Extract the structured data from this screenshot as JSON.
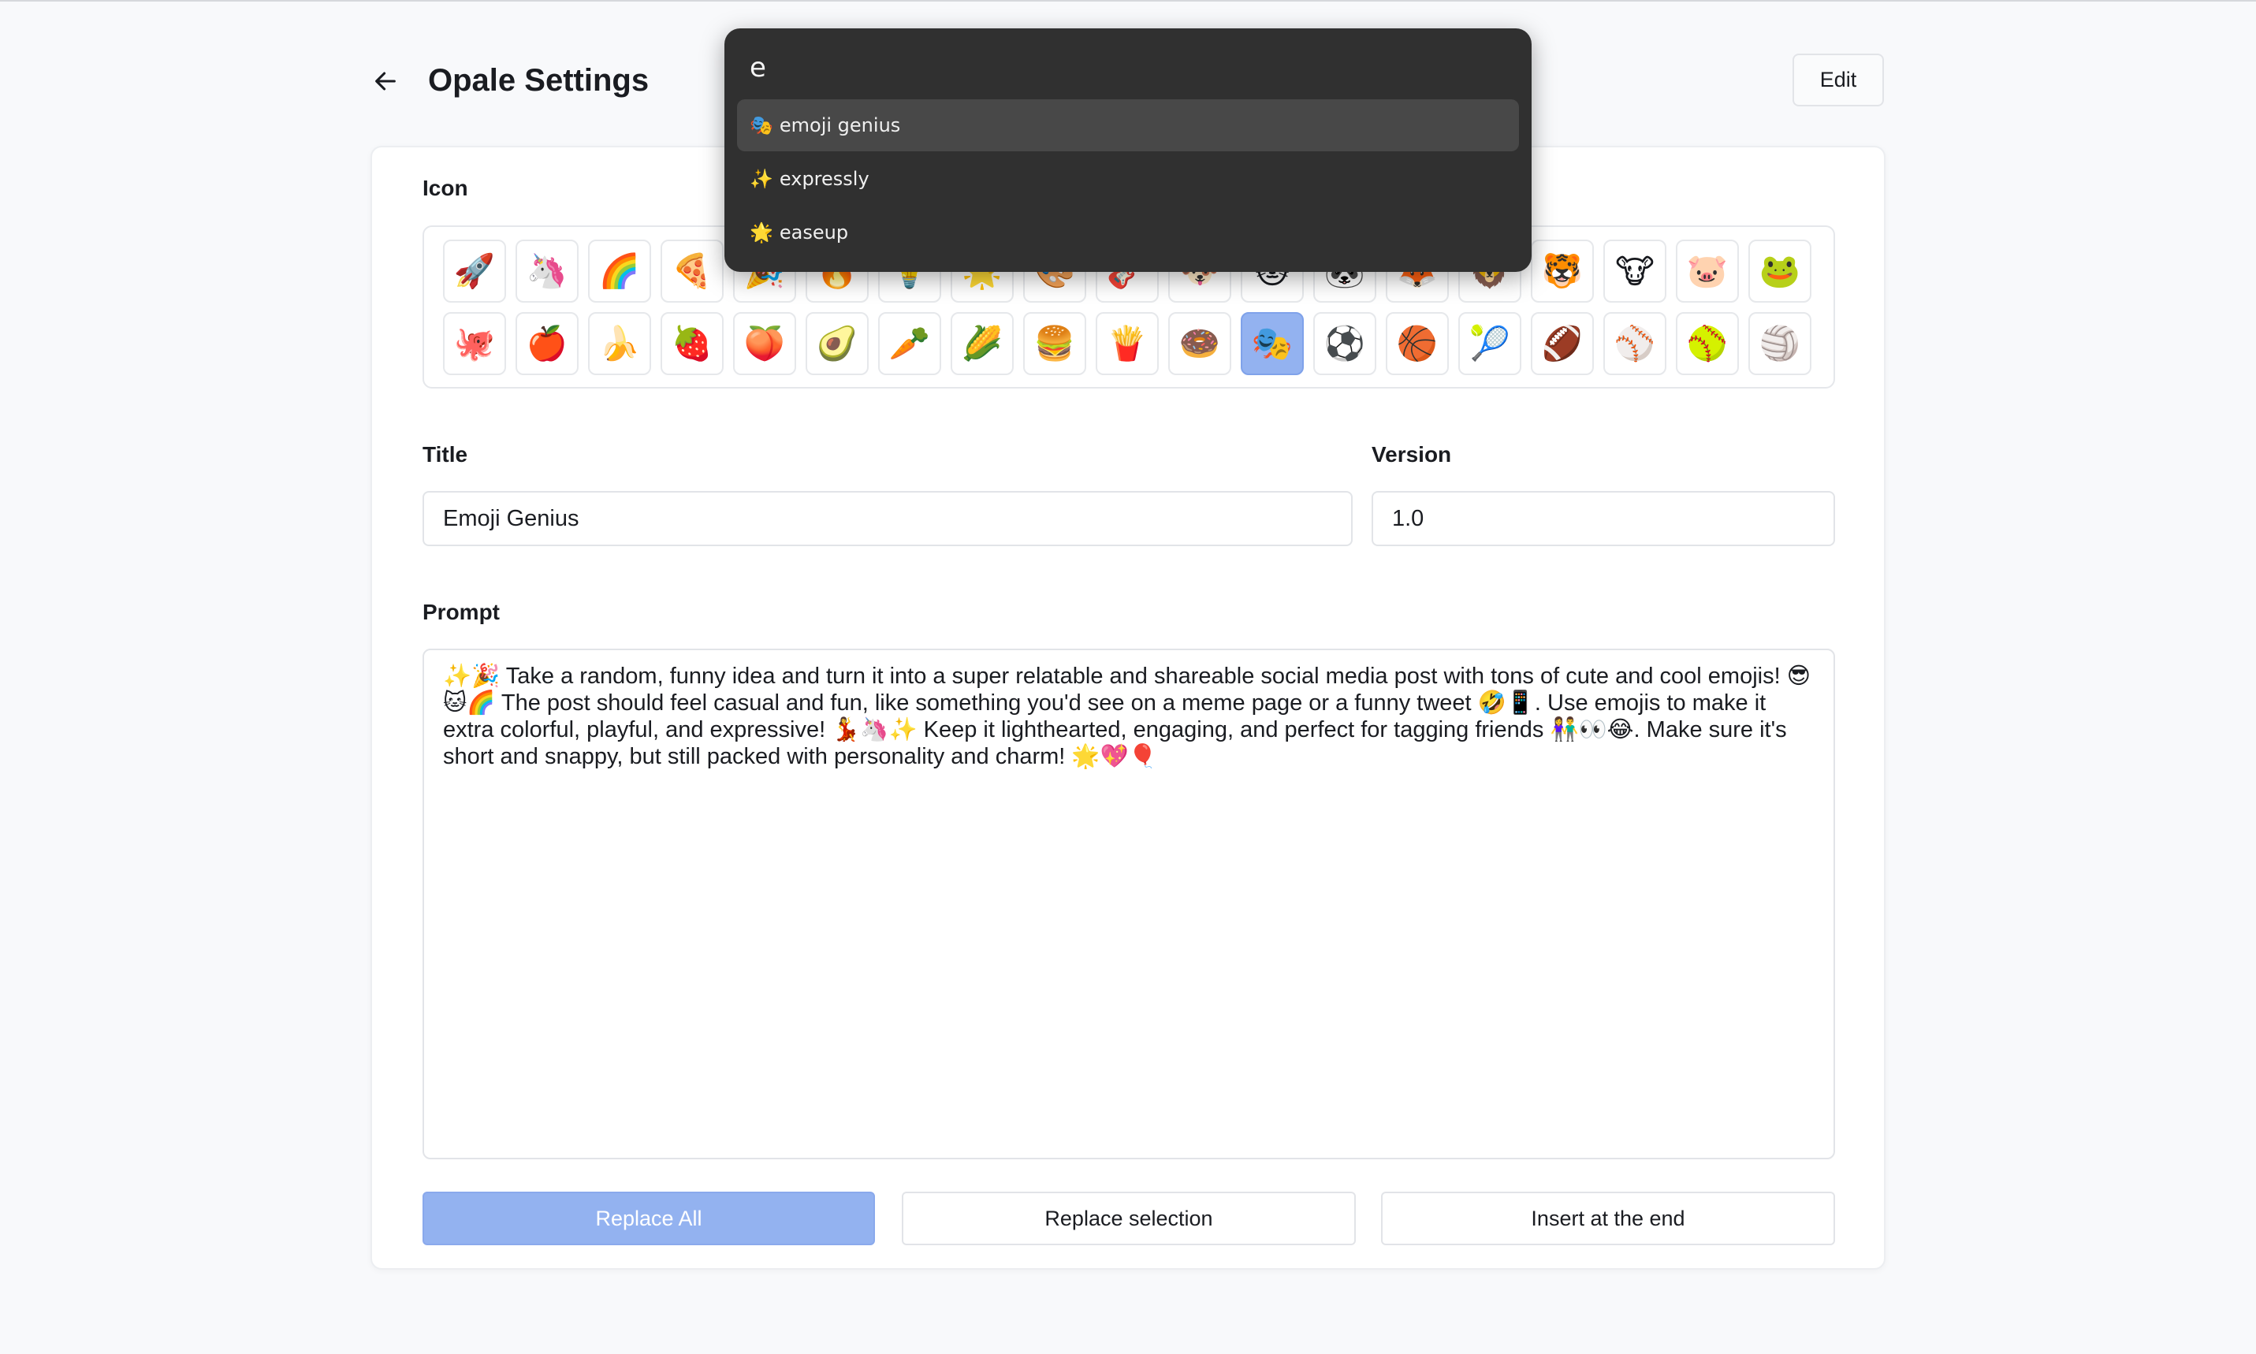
{
  "header": {
    "title": "Opale Settings",
    "back_icon": "arrow-left-icon",
    "edit_label": "Edit"
  },
  "form": {
    "icon_label": "Icon",
    "icons_row1": [
      "🚀",
      "🦄",
      "🌈",
      "🍕",
      "🎉",
      "🔥",
      "💡",
      "🌟",
      "🎨",
      "🎸",
      "🐶",
      "🐱",
      "🐼",
      "🦊",
      "🦁",
      "🐯",
      "🐮",
      "🐷",
      "🐸"
    ],
    "icons_row2": [
      "🐙",
      "🍎",
      "🍌",
      "🍓",
      "🍑",
      "🥑",
      "🥕",
      "🌽",
      "🍔",
      "🍟",
      "🍩",
      "🎭",
      "⚽",
      "🏀",
      "🎾",
      "🏈",
      "⚾",
      "🥎",
      "🏐"
    ],
    "selected_icon": "🎭",
    "title_label": "Title",
    "title_value": "Emoji Genius",
    "version_label": "Version",
    "version_value": "1.0",
    "prompt_label": "Prompt",
    "prompt_value": "✨🎉 Take a random, funny idea and turn it into a super relatable and shareable social media post with tons of cute and cool emojis! 😎🐱🌈 The post should feel casual and fun, like something you'd see on a meme page or a funny tweet 🤣📱. Use emojis to make it extra colorful, playful, and expressive! 💃🦄✨ Keep it lighthearted, engaging, and perfect for tagging friends 👫👀😂. Make sure it's short and snappy, but still packed with personality and charm! 🌟💖🎈"
  },
  "actions": {
    "replace_all": "Replace All",
    "replace_selection": "Replace selection",
    "insert_end": "Insert at the end"
  },
  "palette": {
    "query": "e",
    "items": [
      {
        "emoji": "🎭",
        "label": "emoji genius",
        "active": true
      },
      {
        "emoji": "✨",
        "label": "expressly",
        "active": false
      },
      {
        "emoji": "🌟",
        "label": "easeup",
        "active": false
      }
    ]
  },
  "colors": {
    "accent": "#93b2f0",
    "palette_bg": "#303030",
    "palette_active": "#484848"
  }
}
